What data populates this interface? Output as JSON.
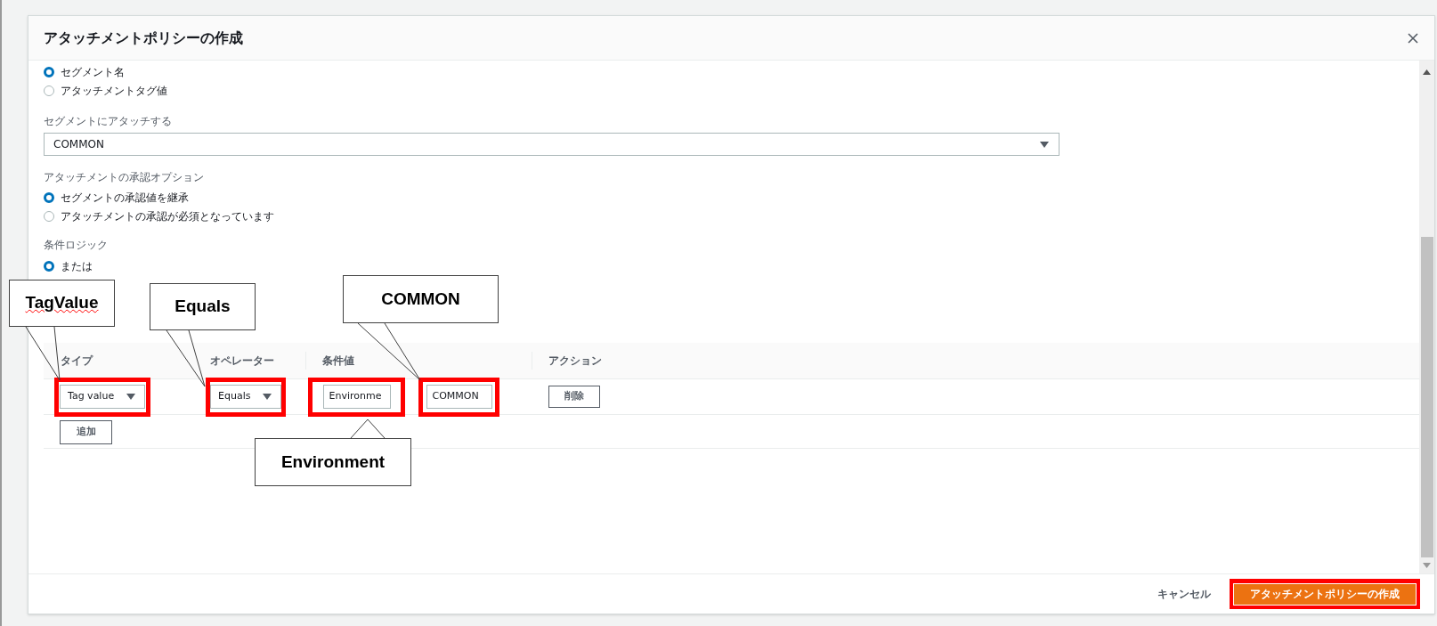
{
  "dialog": {
    "title": "アタッチメントポリシーの作成"
  },
  "attach_by": {
    "options": [
      {
        "label": "セグメント名",
        "selected": true
      },
      {
        "label": "アタッチメントタグ値",
        "selected": false
      }
    ]
  },
  "segment": {
    "label": "セグメントにアタッチする",
    "value": "COMMON"
  },
  "approval": {
    "label": "アタッチメントの承認オプション",
    "options": [
      {
        "label": "セグメントの承認値を継承",
        "selected": true
      },
      {
        "label": "アタッチメントの承認が必須となっています",
        "selected": false
      }
    ]
  },
  "condition_logic": {
    "label": "条件ロジック",
    "options": [
      {
        "label": "または",
        "selected": true
      }
    ]
  },
  "conditions": {
    "columns": [
      "タイプ",
      "オペレーター",
      "条件値",
      "",
      "アクション"
    ],
    "rows": [
      {
        "cells": [
          {
            "kind": "select",
            "value": "Tag value",
            "highlighted": true
          },
          {
            "kind": "select",
            "value": "Equals",
            "highlighted": true
          },
          {
            "kind": "input",
            "value": "Environme",
            "highlighted": true
          },
          {
            "kind": "input",
            "value": "COMMON",
            "highlighted": true
          },
          {
            "kind": "button",
            "value": "削除",
            "highlighted": false
          }
        ]
      }
    ],
    "add_button": "追加"
  },
  "annotations": [
    {
      "text": "TagValue",
      "misspelled": true
    },
    {
      "text": "Equals",
      "misspelled": false
    },
    {
      "text": "COMMON",
      "misspelled": false
    },
    {
      "text": "Environment",
      "misspelled": false
    }
  ],
  "footer": {
    "cancel": "キャンセル",
    "submit": {
      "label": "アタッチメントポリシーの作成",
      "highlighted": true
    }
  }
}
